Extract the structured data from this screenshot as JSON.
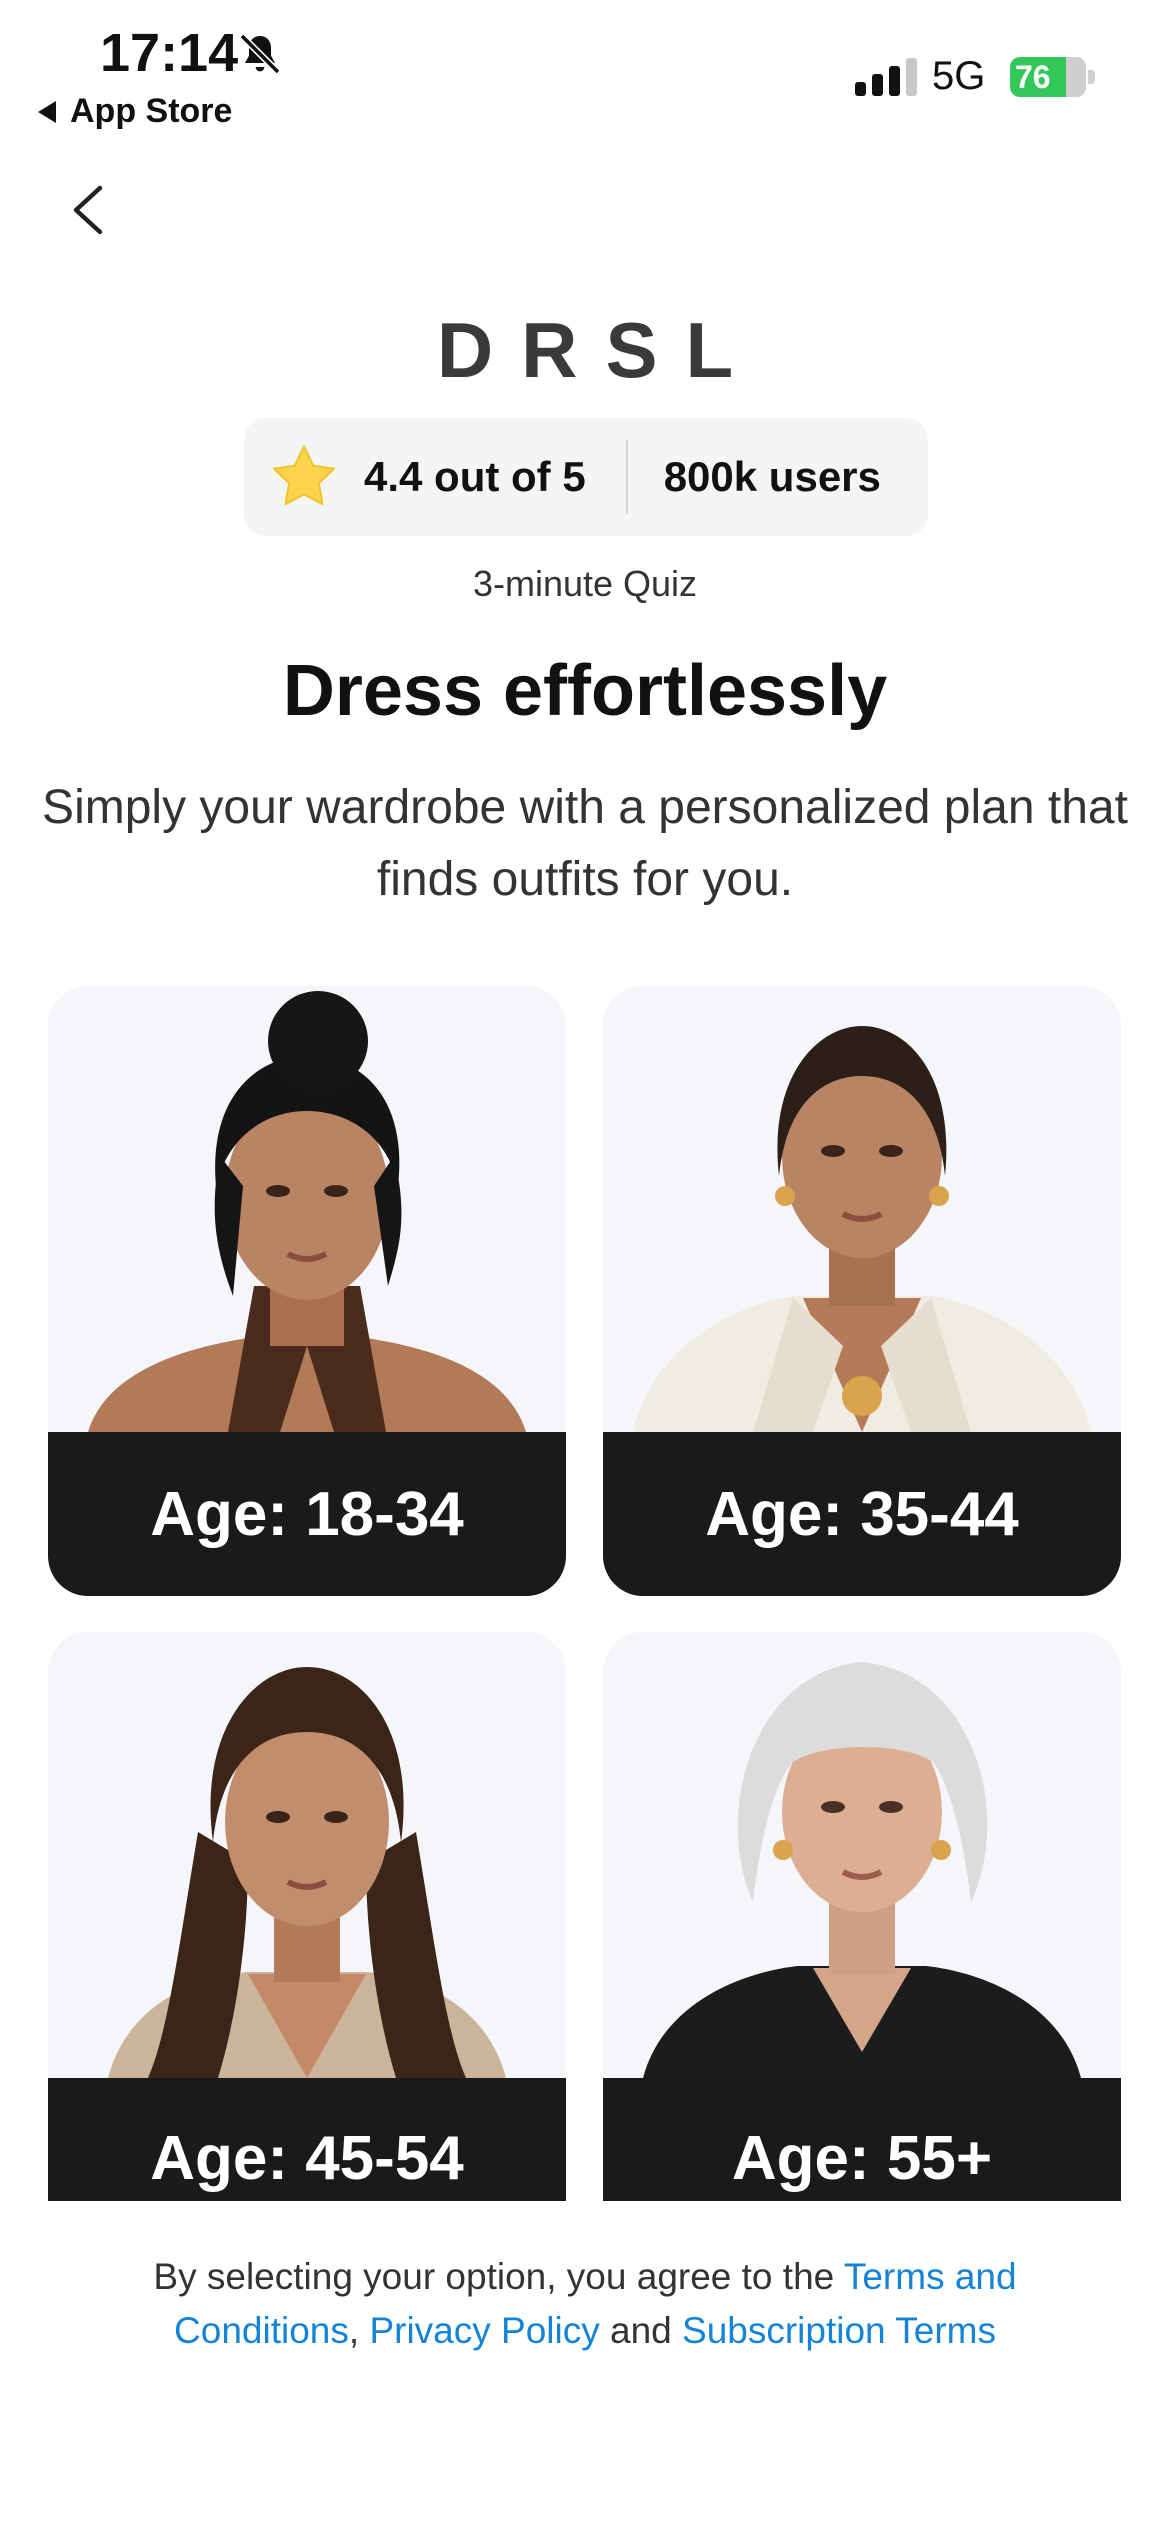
{
  "status_bar": {
    "time": "17:14",
    "back_app": "App Store",
    "network": "5G",
    "battery": "76"
  },
  "brand": {
    "logo": "DRSL"
  },
  "rating": {
    "score_text": "4.4 out of 5",
    "users_text": "800k users"
  },
  "quiz_label": "3-minute Quiz",
  "title": "Dress effortlessly",
  "subtitle": "Simply your wardrobe with a personalized plan that finds outfits for you.",
  "age_options": [
    {
      "label": "Age: 18-34"
    },
    {
      "label": "Age: 35-44"
    },
    {
      "label": "Age: 45-54"
    },
    {
      "label": "Age: 55+"
    }
  ],
  "footer": {
    "prefix": "By selecting your option, you agree to the ",
    "terms_link": "Terms and Conditions",
    "sep1": ", ",
    "privacy_link": "Privacy Policy",
    "and_text": " and ",
    "subscription_link": "Subscription Terms"
  },
  "colors": {
    "accent_link": "#1583d6",
    "card_label_bg": "#1a1a1a",
    "card_bg": "#f4f6f9",
    "battery_green": "#34c759",
    "star": "#fcd34d"
  }
}
